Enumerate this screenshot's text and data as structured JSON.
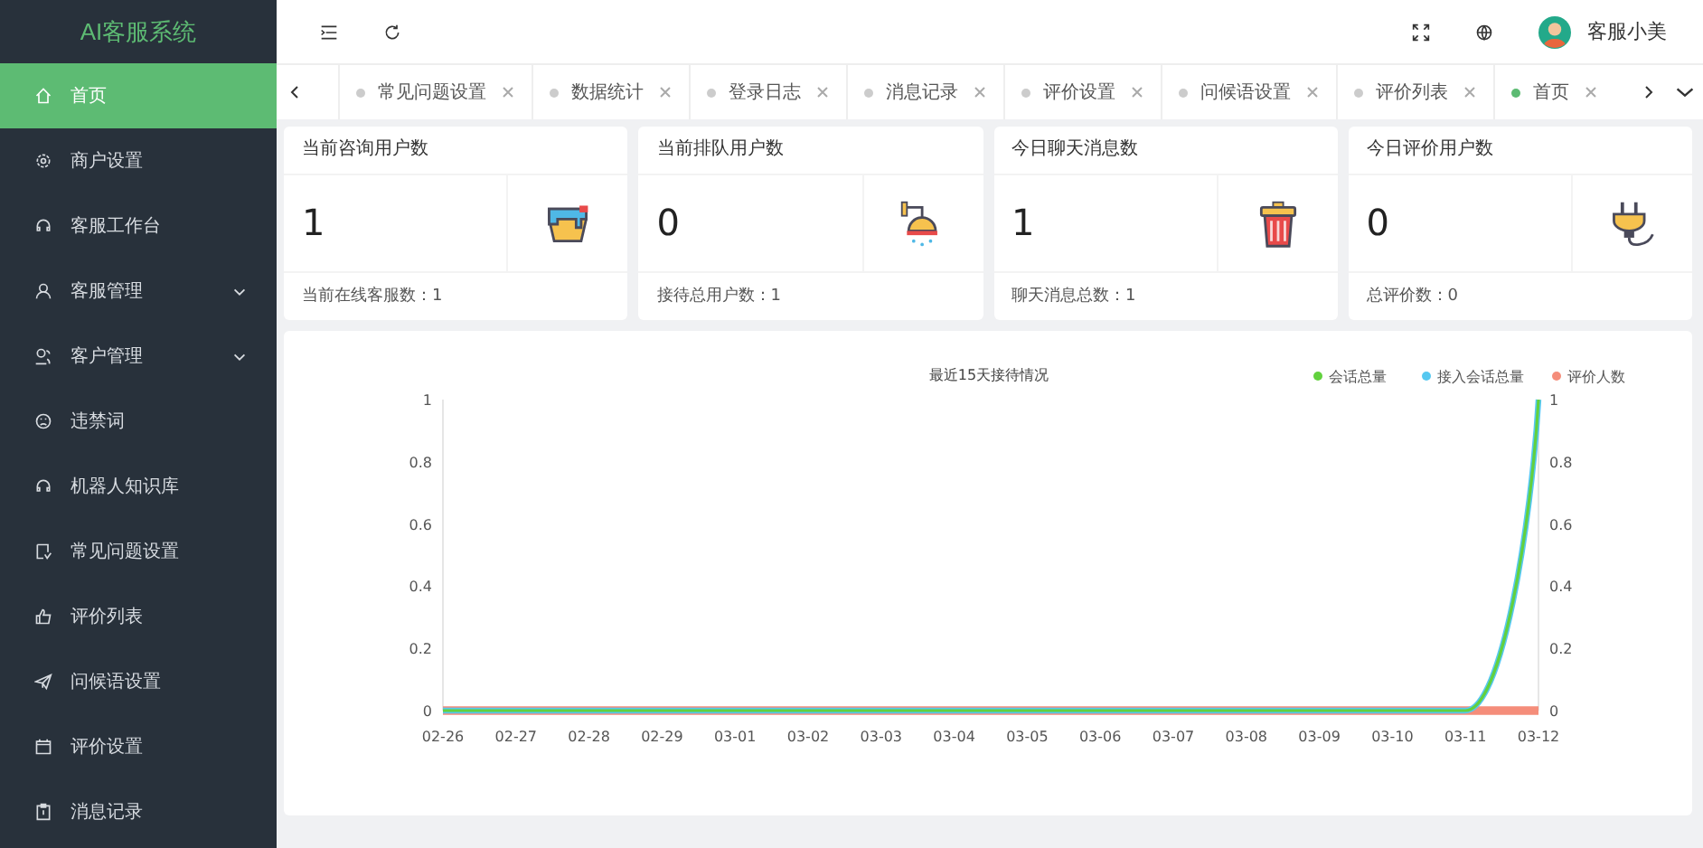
{
  "sidebar": {
    "logo": "AI客服系统",
    "items": [
      {
        "label": "首页",
        "selected": true
      },
      {
        "label": "商户设置",
        "selected": false
      },
      {
        "label": "客服工作台",
        "selected": false
      },
      {
        "label": "客服管理",
        "selected": false,
        "expanded": false
      },
      {
        "label": "客户管理",
        "selected": false,
        "expanded": false
      },
      {
        "label": "违禁词",
        "selected": false
      },
      {
        "label": "机器人知识库",
        "selected": false
      },
      {
        "label": "常见问题设置",
        "selected": false
      },
      {
        "label": "评价列表",
        "selected": false
      },
      {
        "label": "问候语设置",
        "selected": false
      },
      {
        "label": "评价设置",
        "selected": false
      },
      {
        "label": "消息记录",
        "selected": false
      }
    ]
  },
  "header": {
    "user": "客服小美"
  },
  "tabs": [
    {
      "label": "常见问题设置",
      "selected": false
    },
    {
      "label": "数据统计",
      "selected": false
    },
    {
      "label": "登录日志",
      "selected": false
    },
    {
      "label": "消息记录",
      "selected": false
    },
    {
      "label": "评价设置",
      "selected": false
    },
    {
      "label": "问候语设置",
      "selected": false
    },
    {
      "label": "评价列表",
      "selected": false
    },
    {
      "label": "首页",
      "selected": true
    }
  ],
  "stats": [
    {
      "title": "当前咨询用户数",
      "value": "1",
      "footer": "当前在线客服数：1"
    },
    {
      "title": "当前排队用户数",
      "value": "0",
      "footer": "接待总用户数：1"
    },
    {
      "title": "今日聊天消息数",
      "value": "1",
      "footer": "聊天消息总数：1"
    },
    {
      "title": "今日评价用户数",
      "value": "0",
      "footer": "总评价数：0"
    }
  ],
  "chart": {
    "chart_data": {
      "type": "line",
      "title": "最近15天接待情况",
      "categories": [
        "02-26",
        "02-27",
        "02-28",
        "02-29",
        "03-01",
        "03-02",
        "03-03",
        "03-04",
        "03-05",
        "03-06",
        "03-07",
        "03-08",
        "03-09",
        "03-10",
        "03-11",
        "03-12"
      ],
      "series": [
        {
          "name": "会话总量",
          "color": "#62d13e",
          "values": [
            0,
            0,
            0,
            0,
            0,
            0,
            0,
            0,
            0,
            0,
            0,
            0,
            0,
            0,
            0,
            1
          ]
        },
        {
          "name": "接入会话总量",
          "color": "#56c8f0",
          "values": [
            0,
            0,
            0,
            0,
            0,
            0,
            0,
            0,
            0,
            0,
            0,
            0,
            0,
            0,
            0,
            1
          ]
        },
        {
          "name": "评价人数",
          "color": "#f58d7a",
          "values": [
            0,
            0,
            0,
            0,
            0,
            0,
            0,
            0,
            0,
            0,
            0,
            0,
            0,
            0,
            0,
            0
          ]
        }
      ],
      "ylim": [
        0,
        1
      ],
      "yticks": [
        0,
        0.2,
        0.4,
        0.6,
        0.8,
        1
      ],
      "y2lim": [
        0,
        1
      ],
      "y2ticks": [
        0,
        0.2,
        0.4,
        0.6,
        0.8,
        1
      ],
      "legend": "top-right"
    }
  }
}
